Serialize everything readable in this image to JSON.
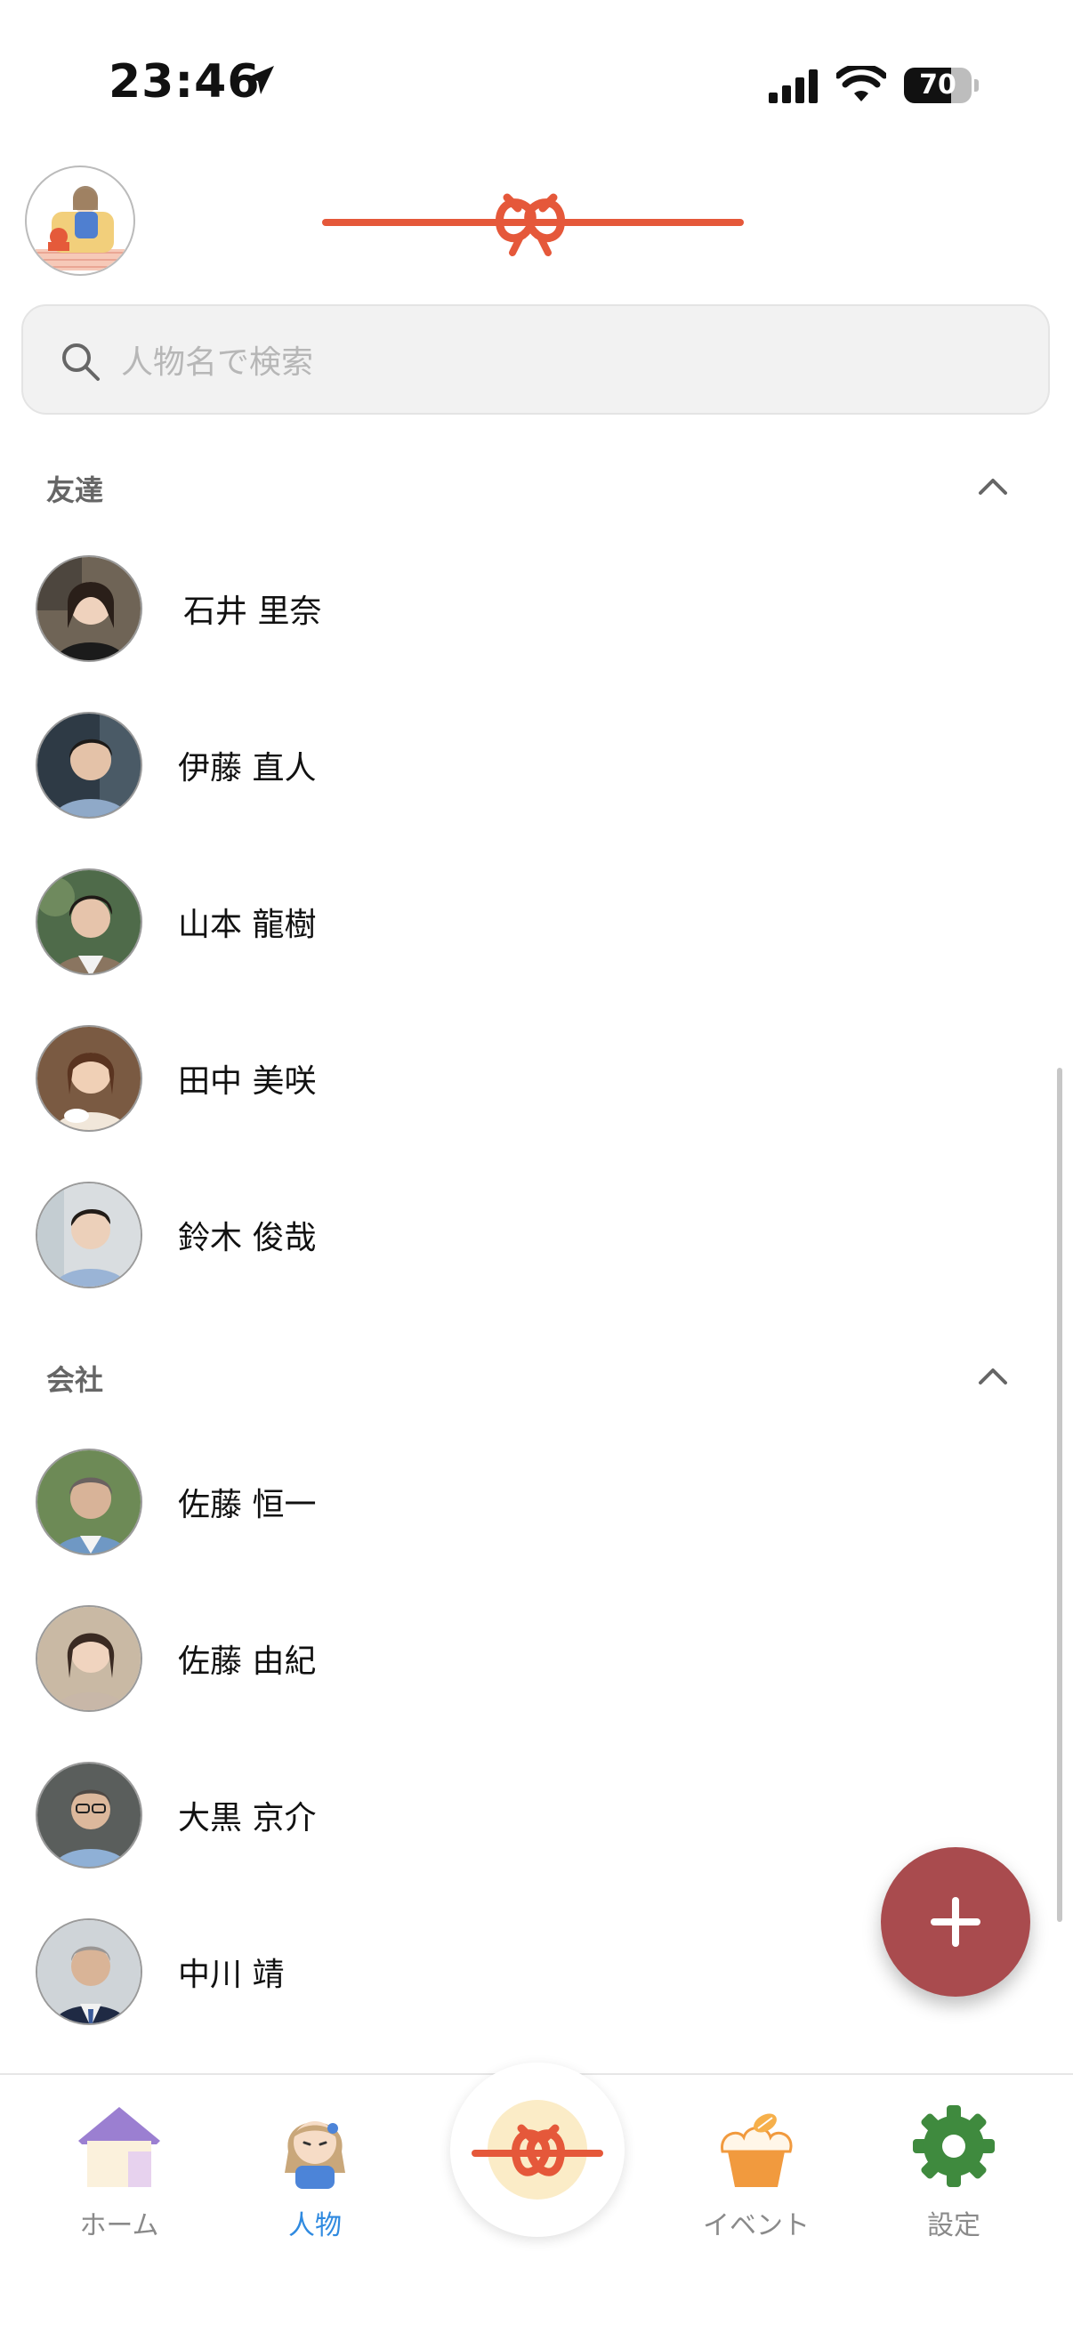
{
  "status": {
    "time": "23:46",
    "battery": "70",
    "battery_level": 0.7
  },
  "search": {
    "placeholder": "人物名で検索"
  },
  "sections": [
    {
      "label": "友達",
      "people": [
        "石井 里奈",
        "伊藤 直人",
        "山本 龍樹",
        "田中 美咲",
        "鈴木 俊哉"
      ]
    },
    {
      "label": "会社",
      "people": [
        "佐藤 恒一",
        "佐藤 由紀",
        "大黒 京介",
        "中川 靖"
      ]
    }
  ],
  "tabs": [
    {
      "label": "ホーム",
      "icon": "house-icon"
    },
    {
      "label": "人物",
      "icon": "person-icon"
    },
    {
      "label": "",
      "icon": "knot-icon"
    },
    {
      "label": "イベント",
      "icon": "cake-icon"
    },
    {
      "label": "設定",
      "icon": "gear-icon"
    }
  ],
  "colors": {
    "accent": "#a94b4e",
    "logo": "#e5583a",
    "active_tab": "#2f8ae0"
  }
}
